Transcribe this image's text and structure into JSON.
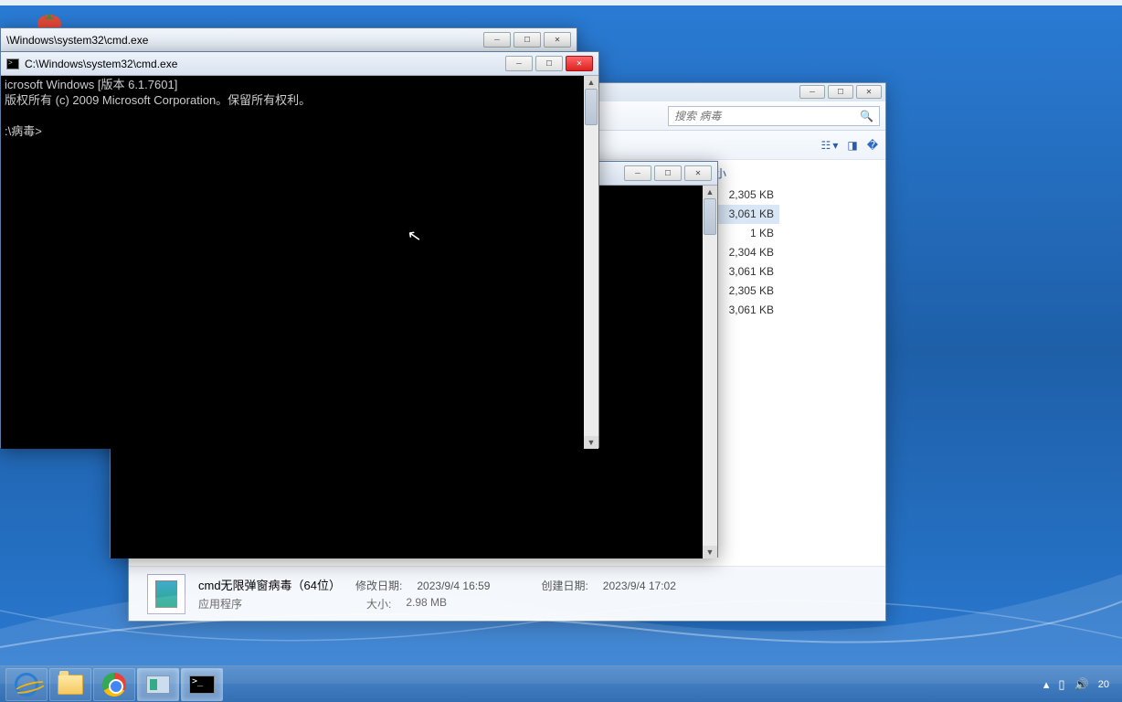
{
  "cmd_back_title": "\\Windows\\system32\\cmd.exe",
  "cmd_front_title": "C:\\Windows\\system32\\cmd.exe",
  "cmd_lines": {
    "l1": "icrosoft Windows [版本 6.1.7601]",
    "l2": "版权所有 (c) 2009 Microsoft Corporation。保留所有权利。",
    "l3": "",
    "l4": ":\\病毒>"
  },
  "explorer": {
    "search_placeholder": "搜索 病毒",
    "size_header": "大小",
    "sizes": [
      "2,305 KB",
      "3,061 KB",
      "1 KB",
      "2,304 KB",
      "3,061 KB",
      "2,305 KB",
      "3,061 KB"
    ],
    "details": {
      "name": "cmd无限弹窗病毒（64位）",
      "type": "应用程序",
      "mod_label": "修改日期:",
      "mod_value": "2023/9/4 16:59",
      "created_label": "创建日期:",
      "created_value": "2023/9/4 17:02",
      "size_label": "大小:",
      "size_value": "2.98 MB"
    }
  },
  "tray_time_partial": "20"
}
